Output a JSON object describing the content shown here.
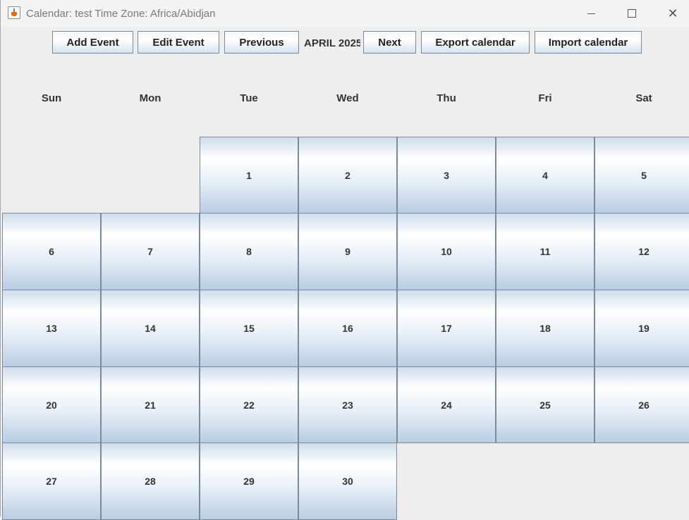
{
  "window": {
    "title": "Calendar: test Time Zone: Africa/Abidjan",
    "minimize_symbol": "",
    "maximize_symbol": "",
    "close_symbol": "✕"
  },
  "toolbar": {
    "add_event": "Add Event",
    "edit_event": "Edit Event",
    "previous": "Previous",
    "month_label": "APRIL 2025",
    "next": "Next",
    "export": "Export calendar",
    "import": "Import calendar"
  },
  "weekdays": [
    "Sun",
    "Mon",
    "Tue",
    "Wed",
    "Thu",
    "Fri",
    "Sat"
  ],
  "days": [
    "1",
    "2",
    "3",
    "4",
    "5",
    "6",
    "7",
    "8",
    "9",
    "10",
    "11",
    "12",
    "13",
    "14",
    "15",
    "16",
    "17",
    "18",
    "19",
    "20",
    "21",
    "22",
    "23",
    "24",
    "25",
    "26",
    "27",
    "28",
    "29",
    "30"
  ],
  "colors": {
    "background": "#eeeeee",
    "cell_border": "#7a8a99",
    "cell_gradient_top": "#cfdcec",
    "cell_gradient_bottom": "#b9cde3",
    "text": "#333333"
  },
  "icons": {
    "app": "java-cup-icon",
    "minimize": "minimize-icon",
    "maximize": "maximize-icon",
    "close": "close-icon"
  }
}
